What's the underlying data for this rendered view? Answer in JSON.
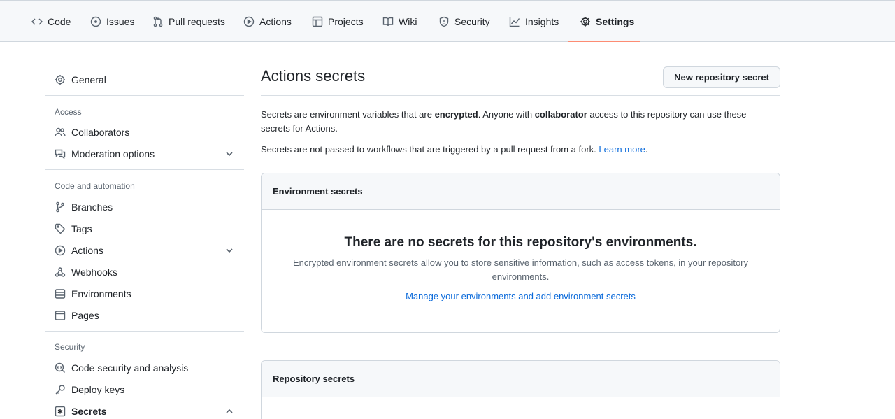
{
  "tabs": [
    {
      "label": "Code"
    },
    {
      "label": "Issues"
    },
    {
      "label": "Pull requests"
    },
    {
      "label": "Actions"
    },
    {
      "label": "Projects"
    },
    {
      "label": "Wiki"
    },
    {
      "label": "Security"
    },
    {
      "label": "Insights"
    },
    {
      "label": "Settings",
      "selected": true
    }
  ],
  "sidebar": {
    "general": "General",
    "access_heading": "Access",
    "collaborators": "Collaborators",
    "moderation": "Moderation options",
    "code_heading": "Code and automation",
    "branches": "Branches",
    "tags": "Tags",
    "actions": "Actions",
    "webhooks": "Webhooks",
    "environments": "Environments",
    "pages": "Pages",
    "security_heading": "Security",
    "code_security": "Code security and analysis",
    "deploy_keys": "Deploy keys",
    "secrets": "Secrets"
  },
  "main": {
    "title": "Actions secrets",
    "new_secret_button": "New repository secret",
    "intro": {
      "p1_a": "Secrets are environment variables that are ",
      "p1_b": "encrypted",
      "p1_c": ". Anyone with ",
      "p1_d": "collaborator",
      "p1_e": " access to this repository can use these secrets for Actions.",
      "p2": "Secrets are not passed to workflows that are triggered by a pull request from a fork. ",
      "p2_link": "Learn more",
      "p2_end": "."
    },
    "env_box": {
      "header": "Environment secrets",
      "blank_title": "There are no secrets for this repository's environments.",
      "blank_desc": "Encrypted environment secrets allow you to store sensitive information, such as access tokens, in your repository environments.",
      "blank_link": "Manage your environments and add environment secrets"
    },
    "repo_box": {
      "header": "Repository secrets"
    }
  },
  "colors": {
    "accent_link": "#0969da",
    "selected_tab_underline": "#fd8c73"
  }
}
